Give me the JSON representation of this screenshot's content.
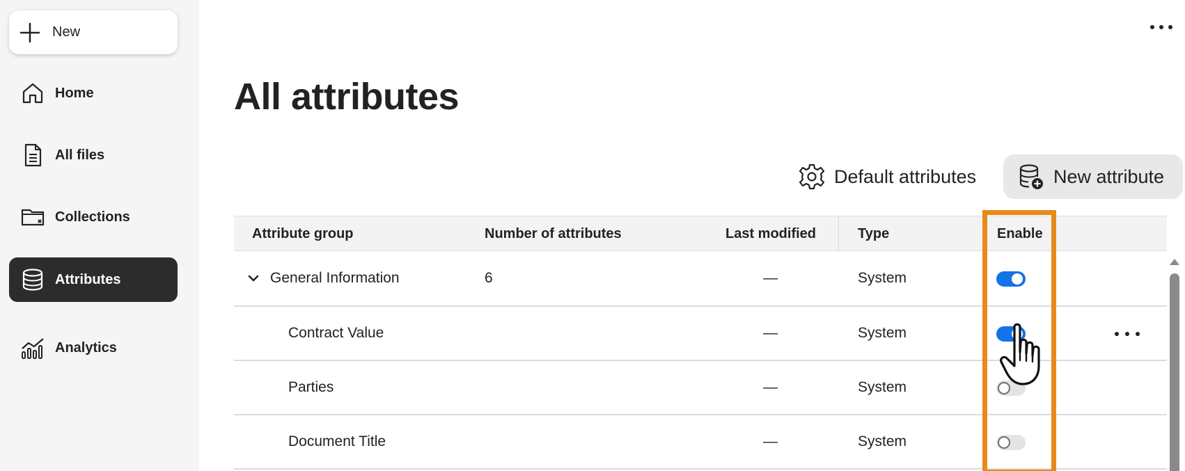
{
  "sidebar": {
    "new_label": "New",
    "items": [
      {
        "label": "Home",
        "icon": "home-icon"
      },
      {
        "label": "All files",
        "icon": "document-icon"
      },
      {
        "label": "Collections",
        "icon": "folder-icon"
      },
      {
        "label": "Attributes",
        "icon": "database-icon",
        "active": true
      },
      {
        "label": "Analytics",
        "icon": "analytics-icon"
      }
    ]
  },
  "main": {
    "title": "All attributes",
    "default_attributes_label": "Default attributes",
    "new_attribute_label": "New attribute"
  },
  "table": {
    "headers": {
      "group": "Attribute group",
      "count": "Number of attributes",
      "modified": "Last modified",
      "type": "Type",
      "enable": "Enable"
    },
    "rows": [
      {
        "name": "General Information",
        "count": "6",
        "modified": "—",
        "type": "System",
        "enabled": true,
        "expanded": true
      },
      {
        "name": "Contract Value",
        "count": "",
        "modified": "—",
        "type": "System",
        "enabled": true
      },
      {
        "name": "Parties",
        "count": "",
        "modified": "—",
        "type": "System",
        "enabled": false
      },
      {
        "name": "Document Title",
        "count": "",
        "modified": "—",
        "type": "System",
        "enabled": false
      }
    ]
  },
  "colors": {
    "accent": "#1473e6",
    "highlight": "#e8891c",
    "active_nav": "#2c2c2c",
    "sidebar_bg": "#f5f5f5"
  }
}
